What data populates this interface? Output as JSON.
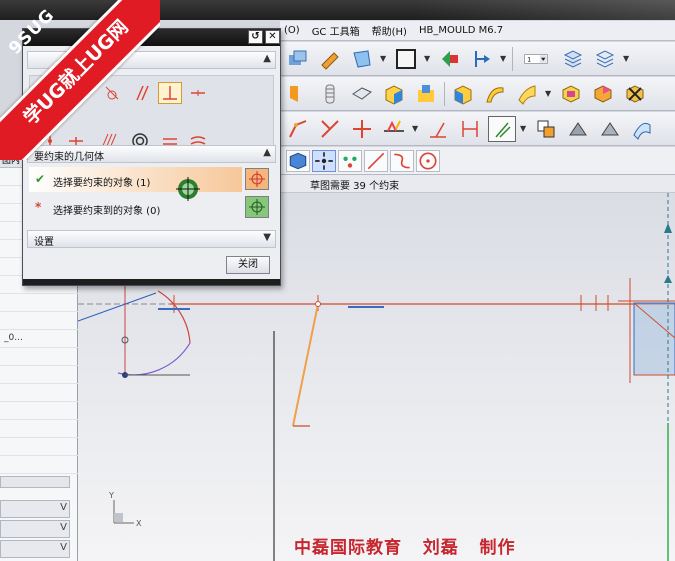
{
  "menu": {
    "items": [
      "(O)",
      "GC 工具箱",
      "帮助(H)",
      "HB_MOULD M6.7"
    ]
  },
  "toolbar": {
    "layer_value": "1"
  },
  "cue_line": "草图需要 39 个约束",
  "nav_panel": {
    "header": "图内",
    "row_text": "_0..."
  },
  "dialog": {
    "sections": {
      "geometry": "要约束的几何体",
      "settings": "设置"
    },
    "steps": [
      {
        "mark": "✔",
        "label": "选择要约束的对象 (1)"
      },
      {
        "mark": "*",
        "label": "选择要约束到的对象 (0)"
      }
    ],
    "close_label": "关闭"
  },
  "watermark": {
    "line1": "9SUG",
    "line2": "学UG就上UG网"
  },
  "credit": "中磊国际教育   刘磊   制作",
  "colors": {
    "sketch_curve": "#d04b2e",
    "selected_curve": "#f0a04a",
    "watermark_red": "#e01b24",
    "credit_red": "#c6262e"
  }
}
